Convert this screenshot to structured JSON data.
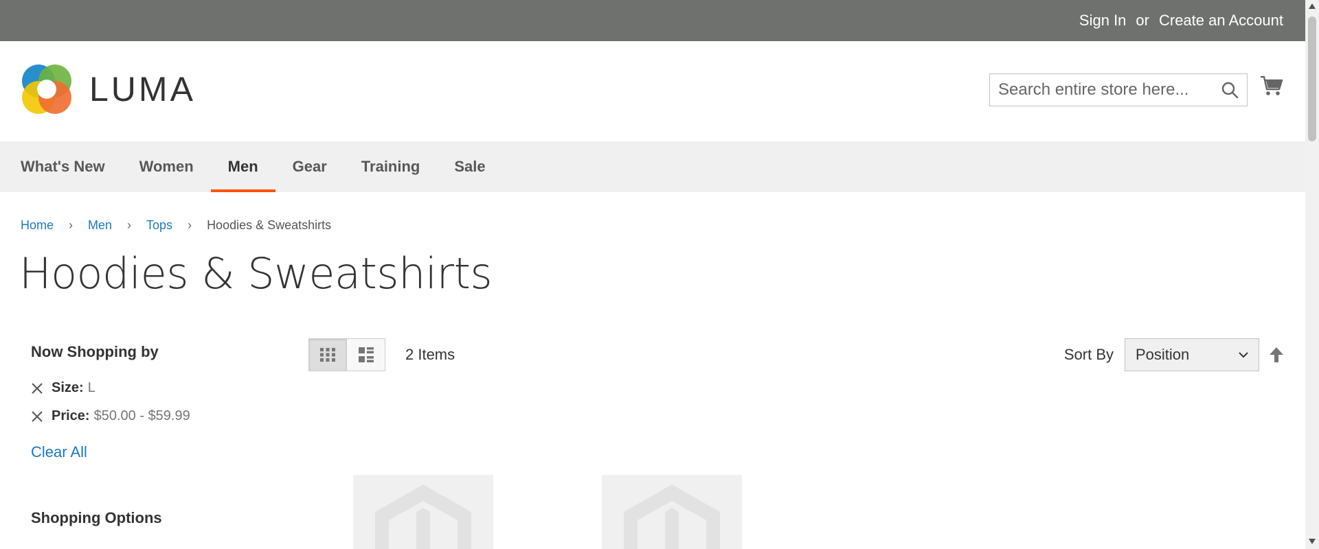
{
  "topbar": {
    "sign_in": "Sign In",
    "or": "or",
    "create_account": "Create an Account"
  },
  "header": {
    "logo_text": "LUMA",
    "search_placeholder": "Search entire store here...",
    "icons": [
      "search-icon",
      "cart-icon"
    ]
  },
  "nav": {
    "items": [
      {
        "label": "What's New"
      },
      {
        "label": "Women"
      },
      {
        "label": "Men",
        "active": true
      },
      {
        "label": "Gear"
      },
      {
        "label": "Training"
      },
      {
        "label": "Sale"
      }
    ]
  },
  "breadcrumb": {
    "items": [
      "Home",
      "Men",
      "Tops",
      "Hoodies & Sweatshirts"
    ]
  },
  "page": {
    "title": "Hoodies & Sweatshirts"
  },
  "sidebar": {
    "now_shopping": "Now Shopping by",
    "filters": [
      {
        "label": "Size:",
        "value": "L"
      },
      {
        "label": "Price:",
        "value": "$50.00 - $59.99"
      }
    ],
    "clear_all": "Clear All",
    "shopping_options": "Shopping Options"
  },
  "toolbar": {
    "amount": "2 Items",
    "sort_label": "Sort By",
    "sort_value": "Position",
    "view_modes": [
      "grid",
      "list"
    ]
  },
  "colors": {
    "topbar_bg": "#6e716e",
    "nav_bg": "#f0f0f0",
    "nav_active_underline": "#ff5501",
    "link": "#1979c3"
  }
}
